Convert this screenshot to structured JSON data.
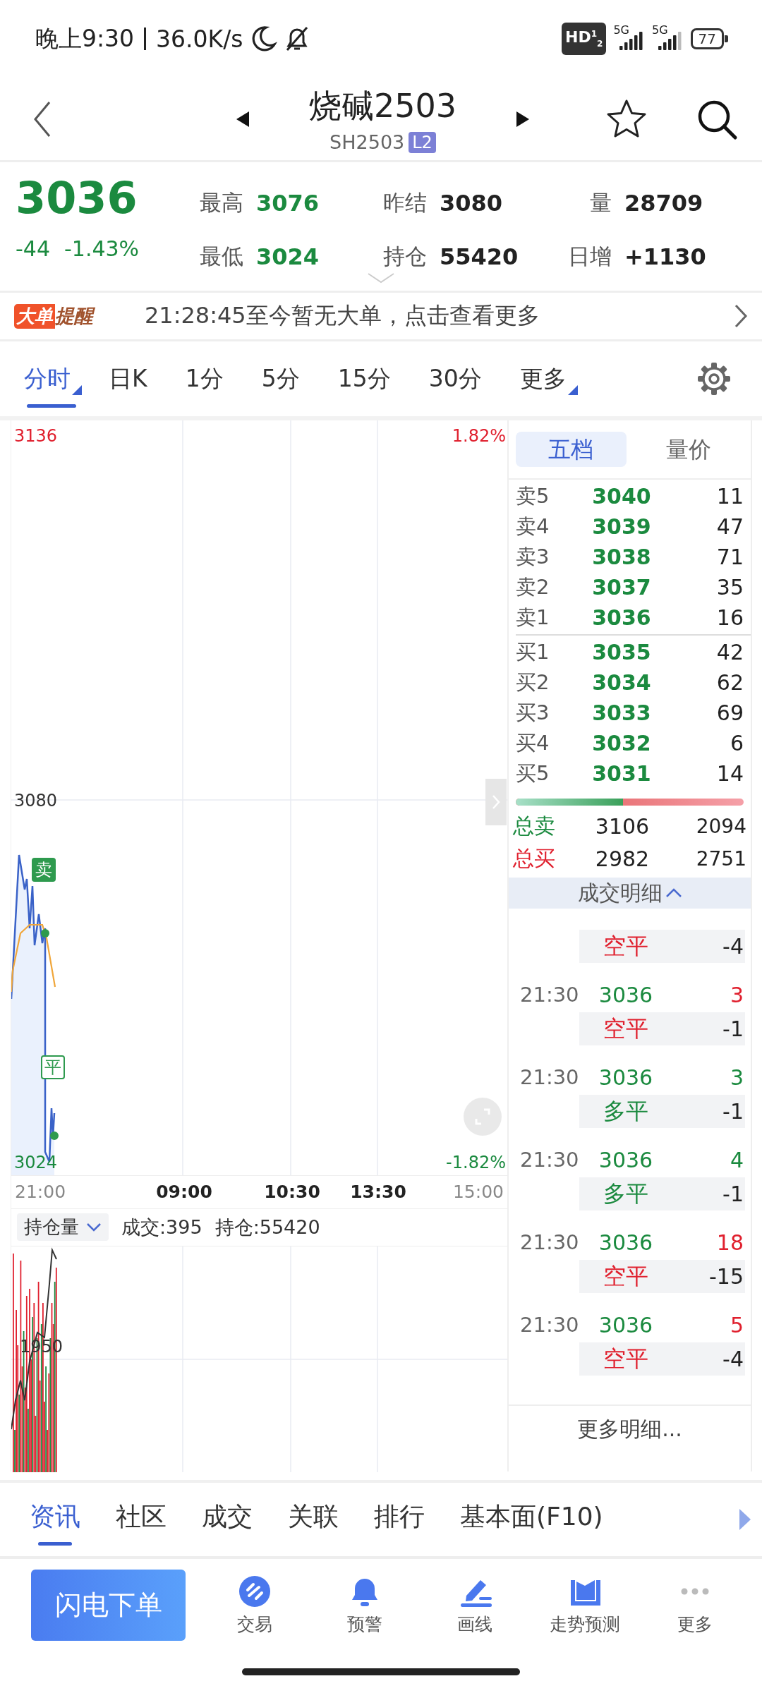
{
  "status_bar": {
    "time": "晚上9:30",
    "speed": "36.0K/s",
    "hd": "HD$^{1}$$_{2}$",
    "signals": [
      {
        "label": "5G",
        "level": 1
      },
      {
        "label": "5G",
        "level": 0.75
      }
    ],
    "battery": "77"
  },
  "header": {
    "title": "烧碱2503",
    "code": "SH2503",
    "badge": "L2",
    "favorite": false
  },
  "quote": {
    "price": "3036",
    "change": "-44",
    "change_pct": "-1.43%",
    "fields": [
      {
        "label": "最高",
        "value": "3076",
        "color": "#1b8a3f"
      },
      {
        "label": "昨结",
        "value": "3080",
        "color": "#222222"
      },
      {
        "label": "量",
        "value": "28709",
        "color": "#222222"
      },
      {
        "label": "最低",
        "value": "3024",
        "color": "#1b8a3f"
      },
      {
        "label": "持仓",
        "value": "55420",
        "color": "#222222"
      },
      {
        "label": "日增",
        "value": "+1130",
        "color": "#222222"
      }
    ]
  },
  "alert": {
    "badge": "大单",
    "title": "提醒",
    "message": "21:28:45至今暂无大单，点击查看更多"
  },
  "period_tabs": [
    {
      "label": "分时",
      "selected": true,
      "dropdown": true
    },
    {
      "label": "日K",
      "selected": false,
      "dropdown": false
    },
    {
      "label": "1分",
      "selected": false,
      "dropdown": false
    },
    {
      "label": "5分",
      "selected": false,
      "dropdown": false
    },
    {
      "label": "15分",
      "selected": false,
      "dropdown": false
    },
    {
      "label": "30分",
      "selected": false,
      "dropdown": false
    },
    {
      "label": "更多",
      "selected": false,
      "dropdown": true
    }
  ],
  "chart": {
    "y_max": "3136",
    "y_base": "3080",
    "y_min": "3024",
    "pct_max": "1.82%",
    "pct_min": "-1.82%",
    "x_labels": [
      {
        "text": "21:00",
        "muted": true
      },
      {
        "text": "09:00",
        "muted": false
      },
      {
        "text": "10:30",
        "muted": false
      },
      {
        "text": "13:30",
        "muted": false
      },
      {
        "text": "15:00",
        "muted": true
      }
    ],
    "markers": [
      {
        "text": "卖",
        "kind": "filled"
      },
      {
        "text": "平",
        "kind": "outline"
      }
    ]
  },
  "volume_panel": {
    "selector": "持仓量",
    "volume": "成交:395",
    "open_interest": "持仓:55420",
    "y_label": "1950"
  },
  "order_book": {
    "tabs": [
      {
        "label": "五档",
        "selected": true
      },
      {
        "label": "量价",
        "selected": false
      }
    ],
    "asks": [
      {
        "label": "卖5",
        "price": "3040",
        "qty": "11"
      },
      {
        "label": "卖4",
        "price": "3039",
        "qty": "47"
      },
      {
        "label": "卖3",
        "price": "3038",
        "qty": "71"
      },
      {
        "label": "卖2",
        "price": "3037",
        "qty": "35"
      },
      {
        "label": "卖1",
        "price": "3036",
        "qty": "16"
      }
    ],
    "bids": [
      {
        "label": "买1",
        "price": "3035",
        "qty": "42"
      },
      {
        "label": "买2",
        "price": "3034",
        "qty": "62"
      },
      {
        "label": "买3",
        "price": "3033",
        "qty": "69"
      },
      {
        "label": "买4",
        "price": "3032",
        "qty": "6"
      },
      {
        "label": "买5",
        "price": "3031",
        "qty": "14"
      }
    ],
    "ratio_bar": {
      "level": 0.47
    },
    "totals": [
      {
        "label": "总卖",
        "price": "3106",
        "qty": "2094",
        "color": "#1b8a3f"
      },
      {
        "label": "总买",
        "price": "2982",
        "qty": "2751",
        "color": "#e0202e"
      }
    ]
  },
  "trades": {
    "title": "成交明细",
    "rows": [
      {
        "type": {
          "text": "空平",
          "color": "#e0202e"
        },
        "change": "-4"
      },
      {
        "time": "21:30",
        "price": "3036",
        "volume": {
          "text": "3",
          "color": "#e0202e"
        },
        "type": {
          "text": "空平",
          "color": "#e0202e"
        },
        "change": "-1"
      },
      {
        "time": "21:30",
        "price": "3036",
        "volume": {
          "text": "3",
          "color": "#1b8a3f"
        },
        "type": {
          "text": "多平",
          "color": "#1b8a3f"
        },
        "change": "-1"
      },
      {
        "time": "21:30",
        "price": "3036",
        "volume": {
          "text": "4",
          "color": "#1b8a3f"
        },
        "type": {
          "text": "多平",
          "color": "#1b8a3f"
        },
        "change": "-1"
      },
      {
        "time": "21:30",
        "price": "3036",
        "volume": {
          "text": "18",
          "color": "#e0202e"
        },
        "type": {
          "text": "空平",
          "color": "#e0202e"
        },
        "change": "-15"
      },
      {
        "time": "21:30",
        "price": "3036",
        "volume": {
          "text": "5",
          "color": "#e0202e"
        },
        "type": {
          "text": "空平",
          "color": "#e0202e"
        },
        "change": "-4"
      }
    ],
    "more": "更多明细..."
  },
  "info_tabs": [
    {
      "label": "资讯",
      "selected": true
    },
    {
      "label": "社区",
      "selected": false
    },
    {
      "label": "成交",
      "selected": false
    },
    {
      "label": "关联",
      "selected": false
    },
    {
      "label": "排行",
      "selected": false
    },
    {
      "label": "基本面(F10)",
      "selected": false
    }
  ],
  "actions": {
    "primary": "闪电下单",
    "items": [
      {
        "label": "交易",
        "kind": "trade"
      },
      {
        "label": "预警",
        "kind": "alert"
      },
      {
        "label": "画线",
        "kind": "draw"
      },
      {
        "label": "走势预测",
        "kind": "forecast"
      },
      {
        "label": "更多",
        "kind": "more"
      }
    ]
  }
}
